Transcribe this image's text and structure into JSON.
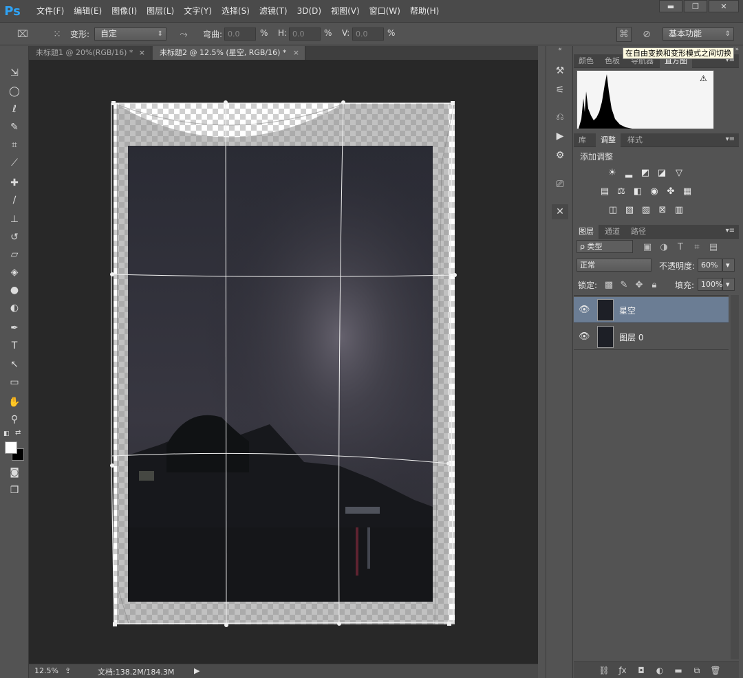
{
  "app": {
    "logo": "Ps"
  },
  "menu": [
    "文件(F)",
    "编辑(E)",
    "图像(I)",
    "图层(L)",
    "文字(Y)",
    "选择(S)",
    "滤镜(T)",
    "3D(D)",
    "视图(V)",
    "窗口(W)",
    "帮助(H)"
  ],
  "window_controls": {
    "minimize": "▬",
    "maximize": "❐",
    "close": "✕"
  },
  "options": {
    "transform_label": "变形:",
    "transform_value": "自定",
    "bend_label": "弯曲:",
    "bend_value": "0.0",
    "h_label": "H:",
    "h_value": "0.0",
    "v_label": "V:",
    "v_value": "0.0",
    "percent": "%",
    "workspace": "基本功能"
  },
  "tooltip": "在自由变换和变形模式之间切换",
  "tabs": [
    {
      "label": "未标题1 @ 20%(RGB/16) *",
      "close": "×",
      "active": false
    },
    {
      "label": "未标题2 @ 12.5% (星空, RGB/16) *",
      "close": "×",
      "active": true
    }
  ],
  "status": {
    "zoom": "12.5%",
    "doc": "文档:138.2M/184.3M",
    "arrow": "▶"
  },
  "panels": {
    "top_tabs": [
      "颜色",
      "色板",
      "导航器",
      "直方图"
    ],
    "warning_icon": "⚠",
    "adj_tabs": [
      "库",
      "调整",
      "样式"
    ],
    "adj_title": "添加调整",
    "layer_tabs": [
      "图层",
      "通道",
      "路径"
    ],
    "filter_label": "ρ 类型",
    "blend_mode": "正常",
    "opacity_label": "不透明度:",
    "opacity_value": "60%",
    "lock_label": "锁定:",
    "fill_label": "填充:",
    "fill_value": "100%",
    "layers": [
      {
        "name": "星空",
        "selected": true
      },
      {
        "name": "图层 0",
        "selected": false
      }
    ],
    "menu_glyph": "▾≡"
  }
}
